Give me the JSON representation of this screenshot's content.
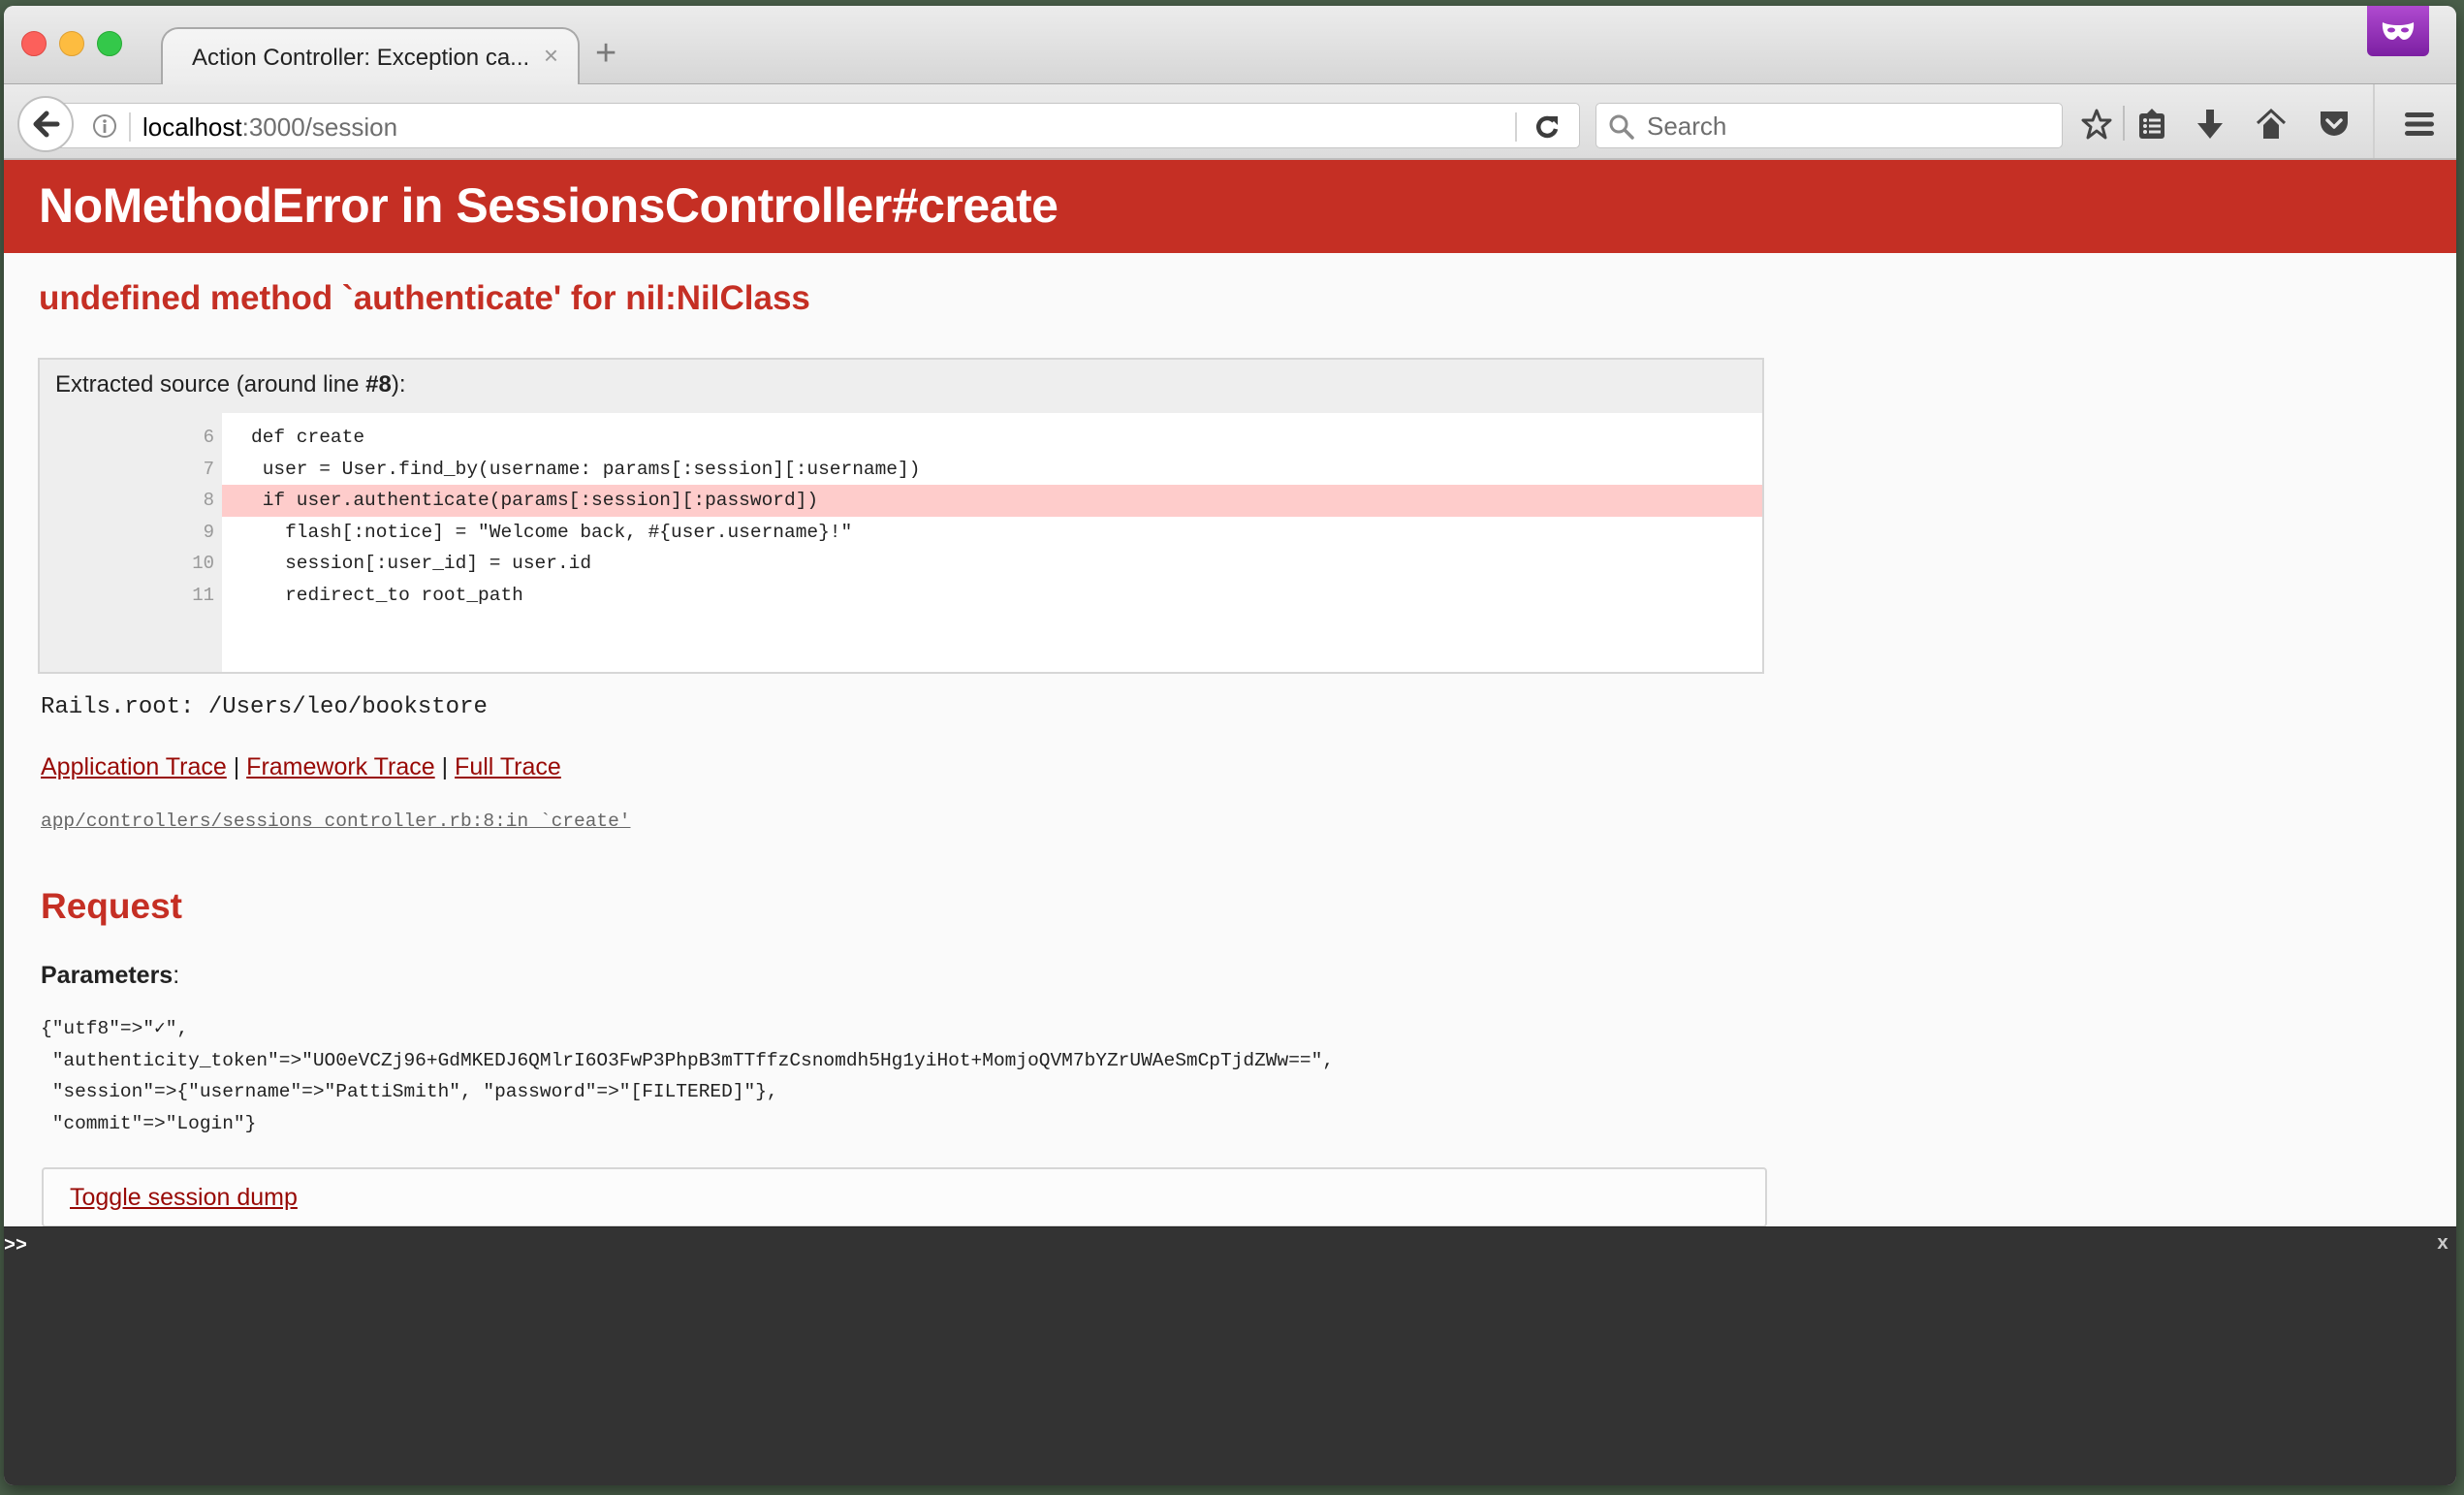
{
  "browser": {
    "tab": {
      "title": "Action Controller: Exception ca...",
      "close_glyph": "×"
    },
    "new_tab_glyph": "+",
    "url": {
      "host": "localhost",
      "rest": ":3000/session"
    },
    "search": {
      "placeholder": "Search",
      "value": ""
    },
    "toolbar_icons": [
      "bookmark-star-icon",
      "bookmarks-list-icon",
      "downloads-icon",
      "home-icon",
      "pocket-icon",
      "hamburger-menu-icon"
    ],
    "private_browsing": true
  },
  "page": {
    "header": {
      "title": "NoMethodError in SessionsController#create"
    },
    "error_message": "undefined method `authenticate' for nil:NilClass",
    "source": {
      "title_prefix": "Extracted source (around line ",
      "title_line": "#8",
      "title_suffix": "):",
      "highlight_line": 8,
      "lines": [
        {
          "num": "6",
          "code": "def create"
        },
        {
          "num": "7",
          "code": " user = User.find_by(username: params[:session][:username])"
        },
        {
          "num": "8",
          "code": " if user.authenticate(params[:session][:password])"
        },
        {
          "num": "9",
          "code": "   flash[:notice] = \"Welcome back, #{user.username}!\""
        },
        {
          "num": "10",
          "code": "   session[:user_id] = user.id"
        },
        {
          "num": "11",
          "code": "   redirect_to root_path"
        }
      ]
    },
    "rails_root": "Rails.root: /Users/leo/bookstore",
    "trace": {
      "links": [
        "Application Trace",
        "Framework Trace",
        "Full Trace"
      ],
      "separator": " | ",
      "entry": "app/controllers/sessions_controller.rb:8:in `create'"
    },
    "request": {
      "title": "Request",
      "params_label": "Parameters",
      "params_colon": ":",
      "params_dump": "{\"utf8\"=>\"✓\",\n \"authenticity_token\"=>\"UO0eVCZj96+GdMKEDJ6QMlrI6O3FwP3PhpB3mTTffzCsnomdh5Hg1yiHot+MomjoQVM7bYZrUWAeSmCpTjdZWw==\",\n \"session\"=>{\"username\"=>\"PattiSmith\", \"password\"=>\"[FILTERED]\"},\n \"commit\"=>\"Login\"}",
      "toggle_session": "Toggle session dump"
    }
  },
  "console": {
    "prompt": ">>",
    "value": "",
    "close_label": "x"
  },
  "colors": {
    "header_red": "#c52f24",
    "link_red": "#980905",
    "highlight": "#fecccb",
    "console_bg": "#333333"
  }
}
